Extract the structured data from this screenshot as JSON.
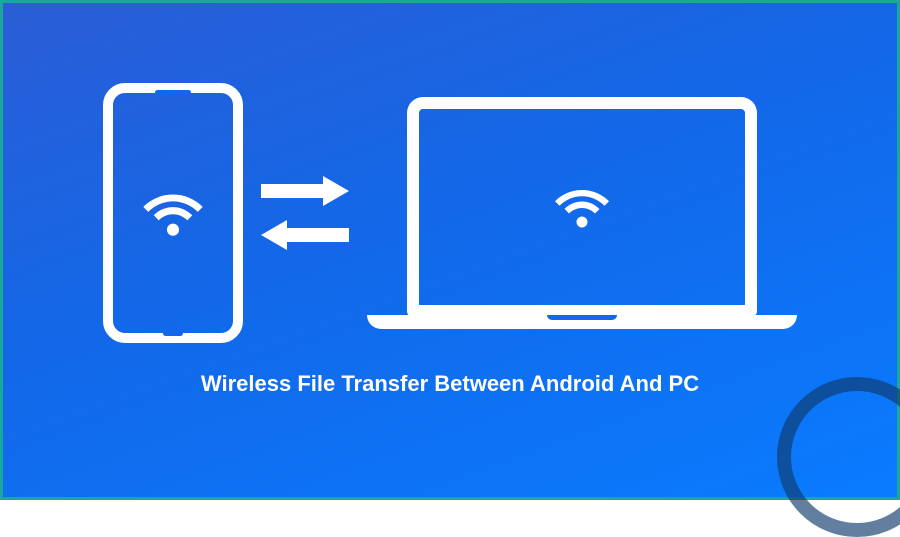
{
  "caption": "Wireless File Transfer Between Android And PC",
  "colors": {
    "background_start": "#2b5dd6",
    "background_end": "#0a7bff",
    "border": "#1aa89a",
    "foreground": "#ffffff",
    "watermark": "#0e3a6b"
  },
  "icons": {
    "phone": "wifi-icon",
    "laptop": "wifi-icon",
    "arrow_top": "arrow-right-icon",
    "arrow_bottom": "arrow-left-icon"
  }
}
